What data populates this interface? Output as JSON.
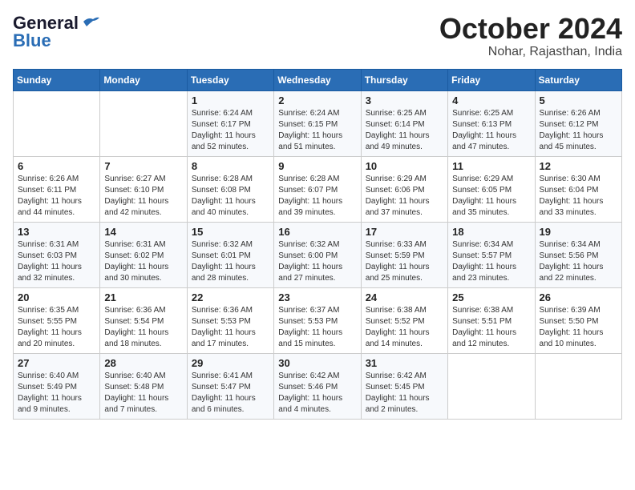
{
  "logo": {
    "line1": "General",
    "line2": "Blue"
  },
  "title": "October 2024",
  "location": "Nohar, Rajasthan, India",
  "days_of_week": [
    "Sunday",
    "Monday",
    "Tuesday",
    "Wednesday",
    "Thursday",
    "Friday",
    "Saturday"
  ],
  "weeks": [
    [
      {
        "day": "",
        "info": ""
      },
      {
        "day": "",
        "info": ""
      },
      {
        "day": "1",
        "info": "Sunrise: 6:24 AM\nSunset: 6:17 PM\nDaylight: 11 hours and 52 minutes."
      },
      {
        "day": "2",
        "info": "Sunrise: 6:24 AM\nSunset: 6:15 PM\nDaylight: 11 hours and 51 minutes."
      },
      {
        "day": "3",
        "info": "Sunrise: 6:25 AM\nSunset: 6:14 PM\nDaylight: 11 hours and 49 minutes."
      },
      {
        "day": "4",
        "info": "Sunrise: 6:25 AM\nSunset: 6:13 PM\nDaylight: 11 hours and 47 minutes."
      },
      {
        "day": "5",
        "info": "Sunrise: 6:26 AM\nSunset: 6:12 PM\nDaylight: 11 hours and 45 minutes."
      }
    ],
    [
      {
        "day": "6",
        "info": "Sunrise: 6:26 AM\nSunset: 6:11 PM\nDaylight: 11 hours and 44 minutes."
      },
      {
        "day": "7",
        "info": "Sunrise: 6:27 AM\nSunset: 6:10 PM\nDaylight: 11 hours and 42 minutes."
      },
      {
        "day": "8",
        "info": "Sunrise: 6:28 AM\nSunset: 6:08 PM\nDaylight: 11 hours and 40 minutes."
      },
      {
        "day": "9",
        "info": "Sunrise: 6:28 AM\nSunset: 6:07 PM\nDaylight: 11 hours and 39 minutes."
      },
      {
        "day": "10",
        "info": "Sunrise: 6:29 AM\nSunset: 6:06 PM\nDaylight: 11 hours and 37 minutes."
      },
      {
        "day": "11",
        "info": "Sunrise: 6:29 AM\nSunset: 6:05 PM\nDaylight: 11 hours and 35 minutes."
      },
      {
        "day": "12",
        "info": "Sunrise: 6:30 AM\nSunset: 6:04 PM\nDaylight: 11 hours and 33 minutes."
      }
    ],
    [
      {
        "day": "13",
        "info": "Sunrise: 6:31 AM\nSunset: 6:03 PM\nDaylight: 11 hours and 32 minutes."
      },
      {
        "day": "14",
        "info": "Sunrise: 6:31 AM\nSunset: 6:02 PM\nDaylight: 11 hours and 30 minutes."
      },
      {
        "day": "15",
        "info": "Sunrise: 6:32 AM\nSunset: 6:01 PM\nDaylight: 11 hours and 28 minutes."
      },
      {
        "day": "16",
        "info": "Sunrise: 6:32 AM\nSunset: 6:00 PM\nDaylight: 11 hours and 27 minutes."
      },
      {
        "day": "17",
        "info": "Sunrise: 6:33 AM\nSunset: 5:59 PM\nDaylight: 11 hours and 25 minutes."
      },
      {
        "day": "18",
        "info": "Sunrise: 6:34 AM\nSunset: 5:57 PM\nDaylight: 11 hours and 23 minutes."
      },
      {
        "day": "19",
        "info": "Sunrise: 6:34 AM\nSunset: 5:56 PM\nDaylight: 11 hours and 22 minutes."
      }
    ],
    [
      {
        "day": "20",
        "info": "Sunrise: 6:35 AM\nSunset: 5:55 PM\nDaylight: 11 hours and 20 minutes."
      },
      {
        "day": "21",
        "info": "Sunrise: 6:36 AM\nSunset: 5:54 PM\nDaylight: 11 hours and 18 minutes."
      },
      {
        "day": "22",
        "info": "Sunrise: 6:36 AM\nSunset: 5:53 PM\nDaylight: 11 hours and 17 minutes."
      },
      {
        "day": "23",
        "info": "Sunrise: 6:37 AM\nSunset: 5:53 PM\nDaylight: 11 hours and 15 minutes."
      },
      {
        "day": "24",
        "info": "Sunrise: 6:38 AM\nSunset: 5:52 PM\nDaylight: 11 hours and 14 minutes."
      },
      {
        "day": "25",
        "info": "Sunrise: 6:38 AM\nSunset: 5:51 PM\nDaylight: 11 hours and 12 minutes."
      },
      {
        "day": "26",
        "info": "Sunrise: 6:39 AM\nSunset: 5:50 PM\nDaylight: 11 hours and 10 minutes."
      }
    ],
    [
      {
        "day": "27",
        "info": "Sunrise: 6:40 AM\nSunset: 5:49 PM\nDaylight: 11 hours and 9 minutes."
      },
      {
        "day": "28",
        "info": "Sunrise: 6:40 AM\nSunset: 5:48 PM\nDaylight: 11 hours and 7 minutes."
      },
      {
        "day": "29",
        "info": "Sunrise: 6:41 AM\nSunset: 5:47 PM\nDaylight: 11 hours and 6 minutes."
      },
      {
        "day": "30",
        "info": "Sunrise: 6:42 AM\nSunset: 5:46 PM\nDaylight: 11 hours and 4 minutes."
      },
      {
        "day": "31",
        "info": "Sunrise: 6:42 AM\nSunset: 5:45 PM\nDaylight: 11 hours and 2 minutes."
      },
      {
        "day": "",
        "info": ""
      },
      {
        "day": "",
        "info": ""
      }
    ]
  ]
}
